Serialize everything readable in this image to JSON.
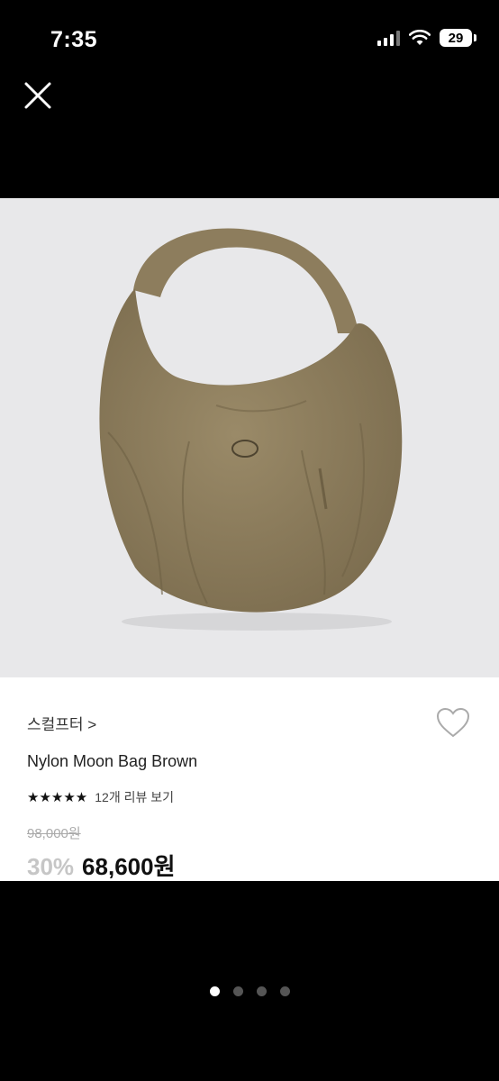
{
  "status": {
    "time": "7:35",
    "battery": "29"
  },
  "product": {
    "brand": "스컬프터 >",
    "name": "Nylon Moon Bag Brown",
    "rating_stars": "★★★★★",
    "review_link": "12개 리뷰 보기",
    "original_price": "98,000원",
    "discount": "30%",
    "price": "68,600원",
    "image": {
      "bag_color": "#8d7d5d",
      "background": "#e8e8ea"
    }
  },
  "carousel": {
    "count": 4,
    "active_index": 0
  },
  "icons": [
    "close-icon",
    "heart-icon",
    "signal-icon",
    "wifi-icon",
    "battery-icon"
  ]
}
